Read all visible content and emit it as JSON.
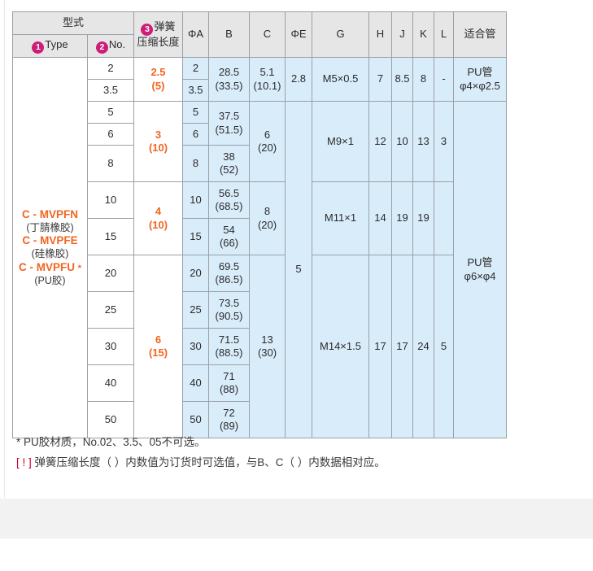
{
  "table": {
    "header": {
      "group_type": "型式",
      "col_type": "Type",
      "col_type_num": "1",
      "col_no": "No.",
      "col_no_num": "2",
      "col_spring_num": "3",
      "col_spring_line1": "弹簧",
      "col_spring_line2": "压缩长度",
      "col_phiA": "ΦA",
      "col_B": "B",
      "col_C": "C",
      "col_phiE": "ΦE",
      "col_G": "G",
      "col_H": "H",
      "col_J": "J",
      "col_K": "K",
      "col_L": "L",
      "col_pipe": "适合管"
    },
    "type_cell": {
      "line1": "C - MVPFN",
      "line2": "(丁腈橡胶)",
      "line3": "C - MVPFE",
      "line4": "(硅橡胶)",
      "line5": "C - MVPFU",
      "line5_star": "*",
      "line6": "(PU胶)"
    },
    "no_values": [
      "2",
      "3.5",
      "5",
      "6",
      "8",
      "10",
      "15",
      "20",
      "25",
      "30",
      "40",
      "50"
    ],
    "spring_lengths": [
      {
        "value": "2.5",
        "paren": "(5)",
        "rows": 2
      },
      {
        "value": "3",
        "paren": "(10)",
        "rows": 3
      },
      {
        "value": "4",
        "paren": "(10)",
        "rows": 2
      },
      {
        "value": "6",
        "paren": "(15)",
        "rows": 5
      }
    ],
    "phiA_values": [
      "2",
      "3.5",
      "5",
      "6",
      "8",
      "10",
      "15",
      "20",
      "25",
      "30",
      "40",
      "50"
    ],
    "B_values": [
      {
        "value": "28.5",
        "paren": "(33.5)",
        "rows": 2
      },
      {
        "value": "37.5",
        "paren": "(51.5)",
        "rows": 2
      },
      {
        "value": "38",
        "paren": "(52)",
        "rows": 1
      },
      {
        "value": "56.5",
        "paren": "(68.5)",
        "rows": 1
      },
      {
        "value": "54",
        "paren": "(66)",
        "rows": 1
      },
      {
        "value": "69.5",
        "paren": "(86.5)",
        "rows": 1
      },
      {
        "value": "73.5",
        "paren": "(90.5)",
        "rows": 1
      },
      {
        "value": "71.5",
        "paren": "(88.5)",
        "rows": 1
      },
      {
        "value": "71",
        "paren": "(88)",
        "rows": 1
      },
      {
        "value": "72",
        "paren": "(89)",
        "rows": 1
      }
    ],
    "C_values": [
      {
        "value": "5.1",
        "paren": "(10.1)",
        "rows": 2
      },
      {
        "value": "6",
        "paren": "(20)",
        "rows": 3
      },
      {
        "value": "8",
        "paren": "(20)",
        "rows": 2
      },
      {
        "value": "13",
        "paren": "(30)",
        "rows": 5
      }
    ],
    "phiE_values": [
      {
        "value": "2.8",
        "rows": 2
      },
      {
        "value": "5",
        "rows": 10
      }
    ],
    "G_values": [
      {
        "value": "M5×0.5",
        "rows": 2
      },
      {
        "value": "M9×1",
        "rows": 3
      },
      {
        "value": "M11×1",
        "rows": 2
      },
      {
        "value": "M14×1.5",
        "rows": 5
      }
    ],
    "H_values": [
      {
        "value": "7",
        "rows": 2
      },
      {
        "value": "12",
        "rows": 3
      },
      {
        "value": "14",
        "rows": 2
      },
      {
        "value": "17",
        "rows": 5
      }
    ],
    "J_values": [
      {
        "value": "8.5",
        "rows": 2
      },
      {
        "value": "10",
        "rows": 3
      },
      {
        "value": "19",
        "rows": 2
      },
      {
        "value": "17",
        "rows": 5
      }
    ],
    "K_values": [
      {
        "value": "8",
        "rows": 2
      },
      {
        "value": "13",
        "rows": 3
      },
      {
        "value": "19",
        "rows": 2
      },
      {
        "value": "24",
        "rows": 5
      }
    ],
    "L_values": [
      {
        "value": "-",
        "rows": 2
      },
      {
        "value": "3",
        "rows": 3
      },
      {
        "value": "",
        "rows": 2
      },
      {
        "value": "5",
        "rows": 5
      }
    ],
    "pipe_values": [
      {
        "line1": "PU管",
        "line2": "φ4×φ2.5",
        "rows": 2
      },
      {
        "line1": "PU管",
        "line2": "φ6×φ4",
        "rows": 10
      }
    ]
  },
  "notes": {
    "note1": "* PU胶材质，No.02、3.5、05不可选。",
    "note2_prefix": "[ ! ]",
    "note2": "弹簧压缩长度（ ）内数值为订货时可选值，与B、C（ ）内数据相对应。"
  },
  "colors": {
    "accent_orange": "#f26522",
    "badge_magenta": "#cc1e78",
    "cell_blue": "#d9ecfa",
    "header_gray": "#e6e6e6",
    "note_red": "#cc0033"
  }
}
